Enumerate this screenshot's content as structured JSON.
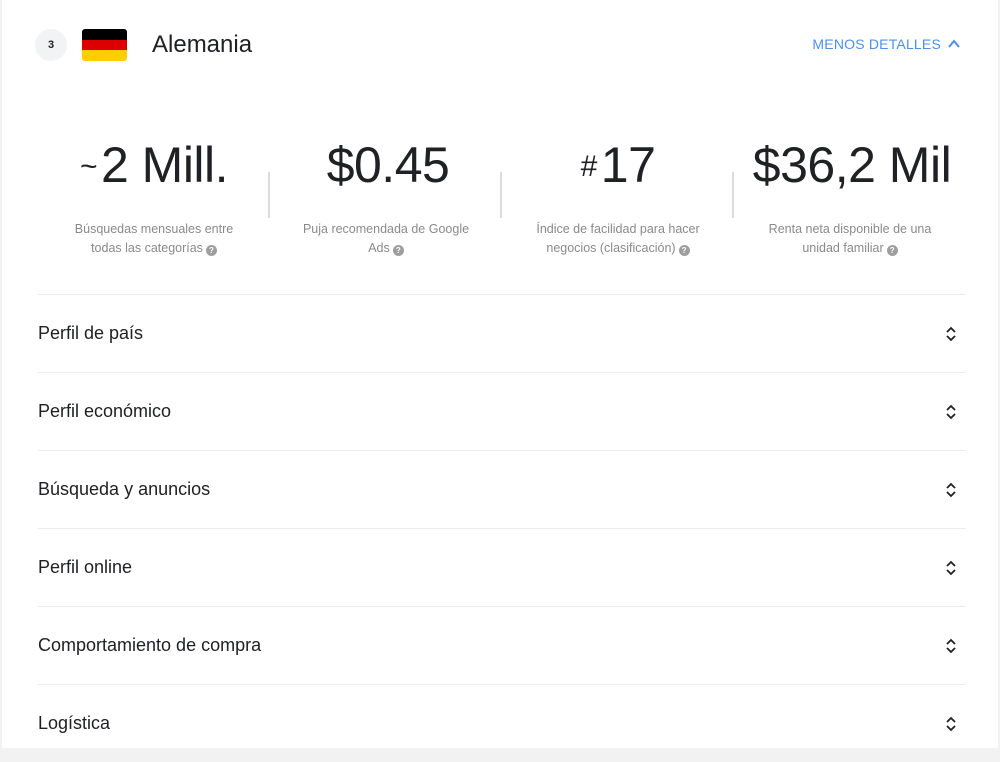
{
  "header": {
    "rank": "3",
    "country": "Alemania",
    "flag_colors": [
      "#000000",
      "#dd0000",
      "#ffce00"
    ],
    "toggle_label": "MENOS DETALLES",
    "toggle_icon": "chevron-up-icon",
    "accent": "#4d8ff0"
  },
  "stats": [
    {
      "prefix": "~",
      "value": "2 Mill.",
      "desc": "Búsquedas mensuales entre todas las categorías"
    },
    {
      "prefix": "",
      "value": "$0.45",
      "desc": "Puja recomendada de Google Ads"
    },
    {
      "prefix": "#",
      "value": "17",
      "desc": "Índice de facilidad para hacer negocios (clasificación)"
    },
    {
      "prefix": "",
      "value": "$36,2 Mil",
      "desc": "Renta neta disponible de una unidad familiar"
    }
  ],
  "help_glyph": "?",
  "sections": [
    {
      "label": "Perfil de país"
    },
    {
      "label": "Perfil económico"
    },
    {
      "label": "Búsqueda y anuncios"
    },
    {
      "label": "Perfil online"
    },
    {
      "label": "Comportamiento de compra"
    },
    {
      "label": "Logística"
    }
  ]
}
